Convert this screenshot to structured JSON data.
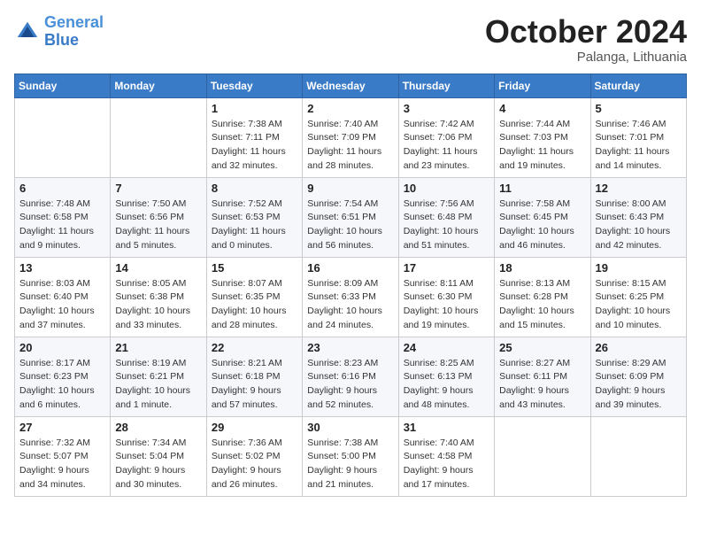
{
  "header": {
    "logo_line1": "General",
    "logo_line2": "Blue",
    "month": "October 2024",
    "location": "Palanga, Lithuania"
  },
  "weekdays": [
    "Sunday",
    "Monday",
    "Tuesday",
    "Wednesday",
    "Thursday",
    "Friday",
    "Saturday"
  ],
  "weeks": [
    [
      {
        "day": "",
        "sunrise": "",
        "sunset": "",
        "daylight": ""
      },
      {
        "day": "",
        "sunrise": "",
        "sunset": "",
        "daylight": ""
      },
      {
        "day": "1",
        "sunrise": "Sunrise: 7:38 AM",
        "sunset": "Sunset: 7:11 PM",
        "daylight": "Daylight: 11 hours and 32 minutes."
      },
      {
        "day": "2",
        "sunrise": "Sunrise: 7:40 AM",
        "sunset": "Sunset: 7:09 PM",
        "daylight": "Daylight: 11 hours and 28 minutes."
      },
      {
        "day": "3",
        "sunrise": "Sunrise: 7:42 AM",
        "sunset": "Sunset: 7:06 PM",
        "daylight": "Daylight: 11 hours and 23 minutes."
      },
      {
        "day": "4",
        "sunrise": "Sunrise: 7:44 AM",
        "sunset": "Sunset: 7:03 PM",
        "daylight": "Daylight: 11 hours and 19 minutes."
      },
      {
        "day": "5",
        "sunrise": "Sunrise: 7:46 AM",
        "sunset": "Sunset: 7:01 PM",
        "daylight": "Daylight: 11 hours and 14 minutes."
      }
    ],
    [
      {
        "day": "6",
        "sunrise": "Sunrise: 7:48 AM",
        "sunset": "Sunset: 6:58 PM",
        "daylight": "Daylight: 11 hours and 9 minutes."
      },
      {
        "day": "7",
        "sunrise": "Sunrise: 7:50 AM",
        "sunset": "Sunset: 6:56 PM",
        "daylight": "Daylight: 11 hours and 5 minutes."
      },
      {
        "day": "8",
        "sunrise": "Sunrise: 7:52 AM",
        "sunset": "Sunset: 6:53 PM",
        "daylight": "Daylight: 11 hours and 0 minutes."
      },
      {
        "day": "9",
        "sunrise": "Sunrise: 7:54 AM",
        "sunset": "Sunset: 6:51 PM",
        "daylight": "Daylight: 10 hours and 56 minutes."
      },
      {
        "day": "10",
        "sunrise": "Sunrise: 7:56 AM",
        "sunset": "Sunset: 6:48 PM",
        "daylight": "Daylight: 10 hours and 51 minutes."
      },
      {
        "day": "11",
        "sunrise": "Sunrise: 7:58 AM",
        "sunset": "Sunset: 6:45 PM",
        "daylight": "Daylight: 10 hours and 46 minutes."
      },
      {
        "day": "12",
        "sunrise": "Sunrise: 8:00 AM",
        "sunset": "Sunset: 6:43 PM",
        "daylight": "Daylight: 10 hours and 42 minutes."
      }
    ],
    [
      {
        "day": "13",
        "sunrise": "Sunrise: 8:03 AM",
        "sunset": "Sunset: 6:40 PM",
        "daylight": "Daylight: 10 hours and 37 minutes."
      },
      {
        "day": "14",
        "sunrise": "Sunrise: 8:05 AM",
        "sunset": "Sunset: 6:38 PM",
        "daylight": "Daylight: 10 hours and 33 minutes."
      },
      {
        "day": "15",
        "sunrise": "Sunrise: 8:07 AM",
        "sunset": "Sunset: 6:35 PM",
        "daylight": "Daylight: 10 hours and 28 minutes."
      },
      {
        "day": "16",
        "sunrise": "Sunrise: 8:09 AM",
        "sunset": "Sunset: 6:33 PM",
        "daylight": "Daylight: 10 hours and 24 minutes."
      },
      {
        "day": "17",
        "sunrise": "Sunrise: 8:11 AM",
        "sunset": "Sunset: 6:30 PM",
        "daylight": "Daylight: 10 hours and 19 minutes."
      },
      {
        "day": "18",
        "sunrise": "Sunrise: 8:13 AM",
        "sunset": "Sunset: 6:28 PM",
        "daylight": "Daylight: 10 hours and 15 minutes."
      },
      {
        "day": "19",
        "sunrise": "Sunrise: 8:15 AM",
        "sunset": "Sunset: 6:25 PM",
        "daylight": "Daylight: 10 hours and 10 minutes."
      }
    ],
    [
      {
        "day": "20",
        "sunrise": "Sunrise: 8:17 AM",
        "sunset": "Sunset: 6:23 PM",
        "daylight": "Daylight: 10 hours and 6 minutes."
      },
      {
        "day": "21",
        "sunrise": "Sunrise: 8:19 AM",
        "sunset": "Sunset: 6:21 PM",
        "daylight": "Daylight: 10 hours and 1 minute."
      },
      {
        "day": "22",
        "sunrise": "Sunrise: 8:21 AM",
        "sunset": "Sunset: 6:18 PM",
        "daylight": "Daylight: 9 hours and 57 minutes."
      },
      {
        "day": "23",
        "sunrise": "Sunrise: 8:23 AM",
        "sunset": "Sunset: 6:16 PM",
        "daylight": "Daylight: 9 hours and 52 minutes."
      },
      {
        "day": "24",
        "sunrise": "Sunrise: 8:25 AM",
        "sunset": "Sunset: 6:13 PM",
        "daylight": "Daylight: 9 hours and 48 minutes."
      },
      {
        "day": "25",
        "sunrise": "Sunrise: 8:27 AM",
        "sunset": "Sunset: 6:11 PM",
        "daylight": "Daylight: 9 hours and 43 minutes."
      },
      {
        "day": "26",
        "sunrise": "Sunrise: 8:29 AM",
        "sunset": "Sunset: 6:09 PM",
        "daylight": "Daylight: 9 hours and 39 minutes."
      }
    ],
    [
      {
        "day": "27",
        "sunrise": "Sunrise: 7:32 AM",
        "sunset": "Sunset: 5:07 PM",
        "daylight": "Daylight: 9 hours and 34 minutes."
      },
      {
        "day": "28",
        "sunrise": "Sunrise: 7:34 AM",
        "sunset": "Sunset: 5:04 PM",
        "daylight": "Daylight: 9 hours and 30 minutes."
      },
      {
        "day": "29",
        "sunrise": "Sunrise: 7:36 AM",
        "sunset": "Sunset: 5:02 PM",
        "daylight": "Daylight: 9 hours and 26 minutes."
      },
      {
        "day": "30",
        "sunrise": "Sunrise: 7:38 AM",
        "sunset": "Sunset: 5:00 PM",
        "daylight": "Daylight: 9 hours and 21 minutes."
      },
      {
        "day": "31",
        "sunrise": "Sunrise: 7:40 AM",
        "sunset": "Sunset: 4:58 PM",
        "daylight": "Daylight: 9 hours and 17 minutes."
      },
      {
        "day": "",
        "sunrise": "",
        "sunset": "",
        "daylight": ""
      },
      {
        "day": "",
        "sunrise": "",
        "sunset": "",
        "daylight": ""
      }
    ]
  ]
}
